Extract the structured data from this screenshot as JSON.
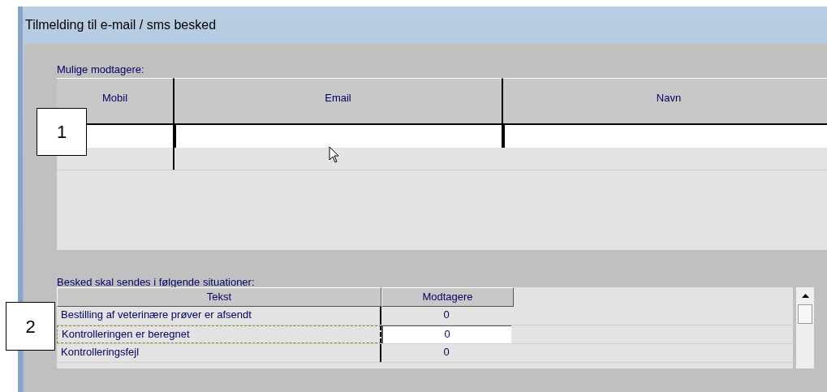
{
  "window": {
    "title": "Tilmelding til e-mail / sms besked"
  },
  "recipients": {
    "label": "Mulige modtagere:",
    "columns": [
      "Mobil",
      "Email",
      "Navn"
    ]
  },
  "situations": {
    "label": "Besked skal sendes i følgende situationer:",
    "columns": [
      "Tekst",
      "Modtagere"
    ],
    "rows": [
      {
        "text": "Bestilling af veterinære prøver er afsendt",
        "count": "0",
        "selected": false
      },
      {
        "text": "Kontrolleringen er beregnet",
        "count": "0",
        "selected": true
      },
      {
        "text": "Kontrolleringsfejl",
        "count": "0",
        "selected": false
      }
    ]
  },
  "callouts": [
    "1",
    "2"
  ]
}
